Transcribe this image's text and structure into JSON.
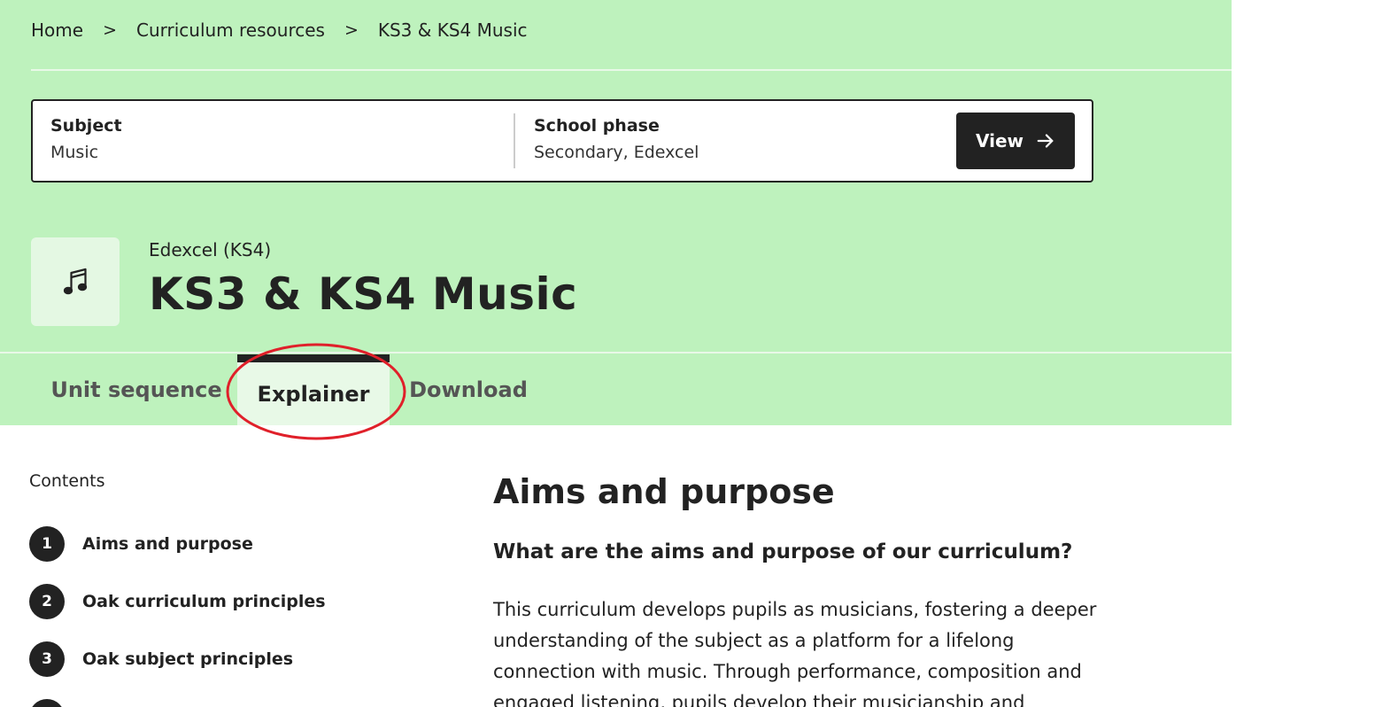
{
  "breadcrumb": {
    "items": [
      "Home",
      "Curriculum resources",
      "KS3 & KS4 Music"
    ],
    "separator": ">"
  },
  "filters": {
    "subject_label": "Subject",
    "subject_value": "Music",
    "phase_label": "School phase",
    "phase_value": "Secondary, Edexcel",
    "view_button": "View"
  },
  "header": {
    "icon": "music-note-icon",
    "exam_board": "Edexcel (KS4)",
    "title": "KS3 & KS4 Music"
  },
  "tabs": [
    {
      "label": "Unit sequence",
      "active": false
    },
    {
      "label": "Explainer",
      "active": true
    },
    {
      "label": "Download",
      "active": false
    }
  ],
  "sidebar": {
    "title": "Contents",
    "items": [
      {
        "number": "1",
        "label": "Aims and purpose"
      },
      {
        "number": "2",
        "label": "Oak curriculum principles"
      },
      {
        "number": "3",
        "label": "Oak subject principles"
      }
    ]
  },
  "main": {
    "title": "Aims and purpose",
    "subtitle": "What are the aims and purpose of our curriculum?",
    "paragraph": "This curriculum develops pupils as musicians, fostering a deeper understanding of the subject as a platform for a lifelong connection with music. Through performance, composition and engaged listening, pupils develop their musicianship and"
  },
  "colors": {
    "hero_background": "#bef2bd",
    "active_tab_background": "#e8f9e7",
    "button_background": "#222222",
    "annotation_circle": "#e0202a"
  }
}
